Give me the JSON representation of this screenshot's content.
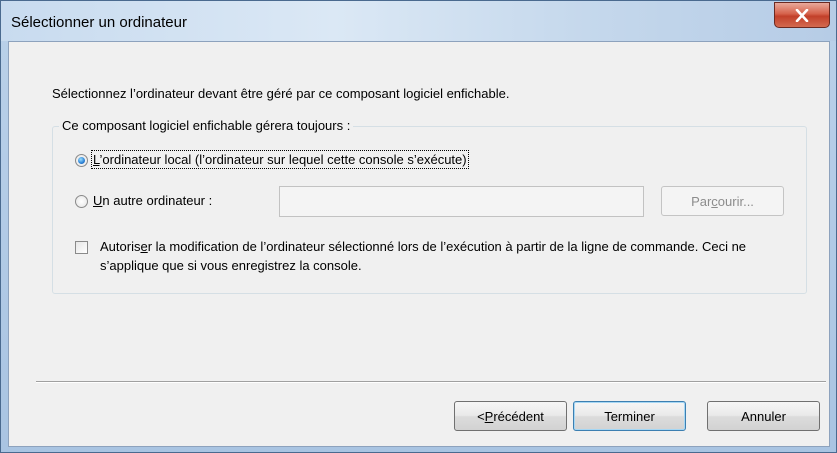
{
  "window": {
    "title": "Sélectionner un ordinateur"
  },
  "dialog": {
    "instruction": "Sélectionnez l’ordinateur devant être géré par ce composant logiciel enfichable.",
    "group_label": "Ce composant logiciel enfichable gérera toujours :",
    "option_local": {
      "prefix": "L",
      "rest": "’ordinateur local (l’ordinateur sur lequel cette console s’exécute)",
      "checked": true
    },
    "option_other": {
      "prefix": "U",
      "rest": "n autre ordinateur :",
      "checked": false,
      "value": ""
    },
    "browse_button": {
      "before": "Par",
      "underlined": "c",
      "after": "ourir..."
    },
    "allow_change": {
      "before": "Autoris",
      "underlined": "e",
      "after": "r la modification de l’ordinateur sélectionné lors de l’exécution à partir de la ligne de commande. Ceci ne s’applique que si vous enregistrez la console.",
      "checked": false
    }
  },
  "footer": {
    "previous": {
      "before": "< ",
      "underlined": "P",
      "after": "récédent"
    },
    "finish": "Terminer",
    "cancel": "Annuler"
  },
  "colors": {
    "client_bg": "#f0f0f0",
    "close_button": "#c2402a",
    "default_button_border": "#3c7fb1"
  }
}
